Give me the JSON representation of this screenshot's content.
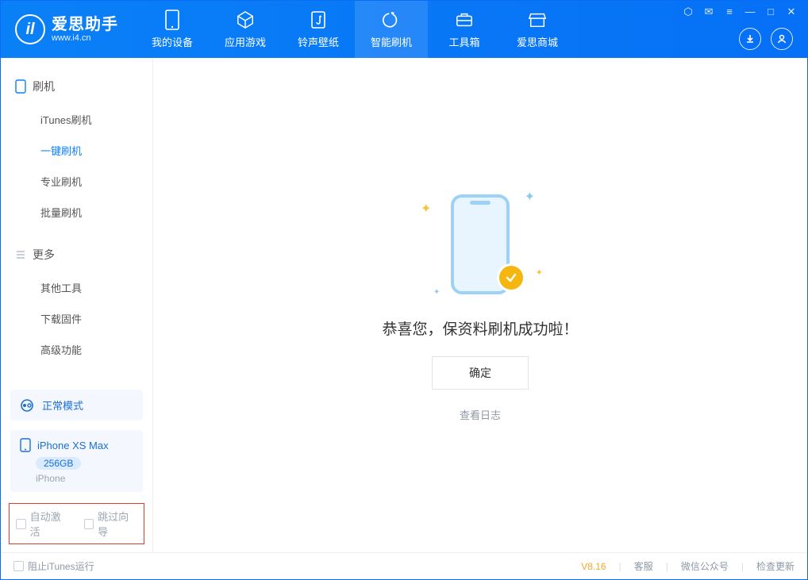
{
  "colors": {
    "primary": "#0a80f7",
    "accent": "#f5b70f",
    "danger": "#e43b2f"
  },
  "logo": {
    "title": "爱思助手",
    "subtitle": "www.i4.cn",
    "glyph": "il"
  },
  "nav": [
    {
      "label": "我的设备",
      "icon": "device-icon"
    },
    {
      "label": "应用游戏",
      "icon": "apps-icon"
    },
    {
      "label": "铃声壁纸",
      "icon": "ringtone-icon"
    },
    {
      "label": "智能刷机",
      "icon": "flash-icon",
      "active": true
    },
    {
      "label": "工具箱",
      "icon": "toolbox-icon"
    },
    {
      "label": "爱思商城",
      "icon": "store-icon"
    }
  ],
  "sidebar": {
    "group1_title": "刷机",
    "group1": [
      {
        "label": "iTunes刷机"
      },
      {
        "label": "一键刷机",
        "active": true
      },
      {
        "label": "专业刷机"
      },
      {
        "label": "批量刷机"
      }
    ],
    "group2_title": "更多",
    "group2": [
      {
        "label": "其他工具"
      },
      {
        "label": "下载固件"
      },
      {
        "label": "高级功能"
      }
    ]
  },
  "mode_card": {
    "label": "正常模式"
  },
  "device_card": {
    "name": "iPhone XS Max",
    "storage": "256GB",
    "type": "iPhone"
  },
  "options": {
    "auto_activate": "自动激活",
    "skip_wizard": "跳过向导"
  },
  "main": {
    "message": "恭喜您，保资料刷机成功啦！",
    "ok": "确定",
    "view_log": "查看日志"
  },
  "footer": {
    "block_itunes": "阻止iTunes运行",
    "version": "V8.16",
    "service": "客服",
    "wechat": "微信公众号",
    "update": "检查更新"
  }
}
